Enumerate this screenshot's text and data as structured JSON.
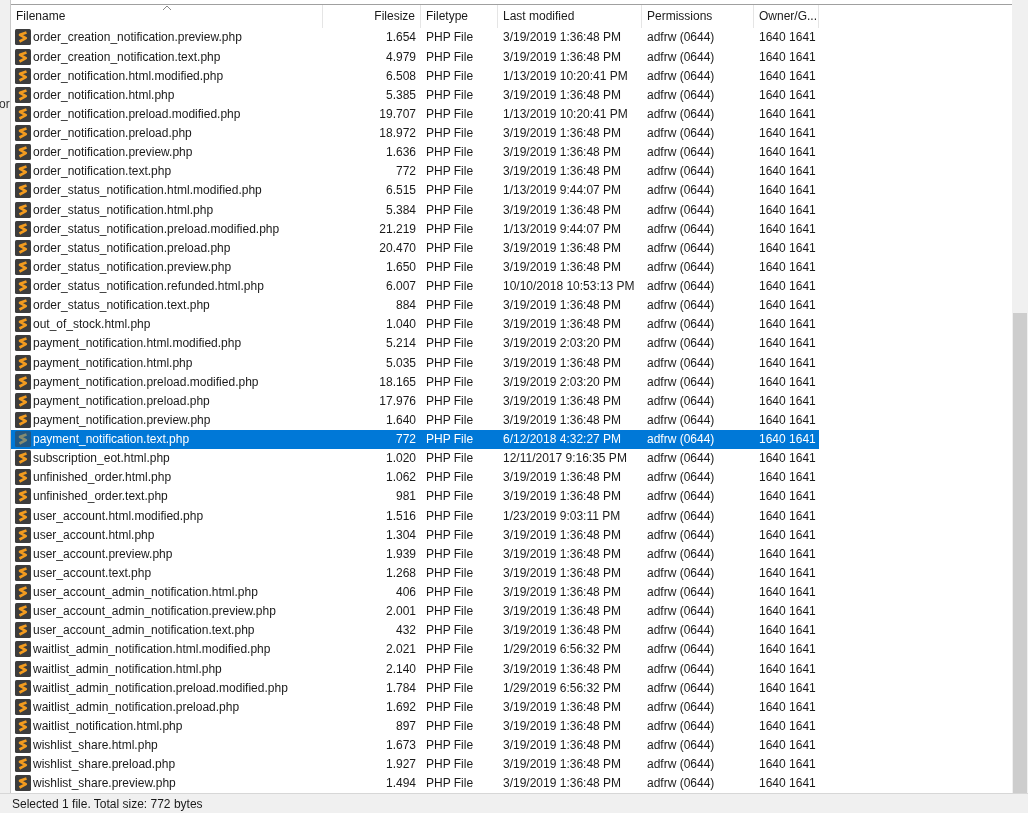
{
  "side_pane": {
    "fragment": "or"
  },
  "table": {
    "columns": [
      {
        "label": "Filename",
        "sorted": true
      },
      {
        "label": "Filesize",
        "sorted": false
      },
      {
        "label": "Filetype",
        "sorted": false
      },
      {
        "label": "Last modified",
        "sorted": false
      },
      {
        "label": "Permissions",
        "sorted": false
      },
      {
        "label": "Owner/G...",
        "sorted": false
      }
    ],
    "rows": [
      {
        "cells": [
          "order_creation_notification.preview.php",
          "1.654",
          "PHP File",
          "3/19/2019 1:36:48 PM",
          "adfrw (0644)",
          "1640 1641"
        ],
        "selected": false
      },
      {
        "cells": [
          "order_creation_notification.text.php",
          "4.979",
          "PHP File",
          "3/19/2019 1:36:48 PM",
          "adfrw (0644)",
          "1640 1641"
        ],
        "selected": false
      },
      {
        "cells": [
          "order_notification.html.modified.php",
          "6.508",
          "PHP File",
          "1/13/2019 10:20:41 PM",
          "adfrw (0644)",
          "1640 1641"
        ],
        "selected": false
      },
      {
        "cells": [
          "order_notification.html.php",
          "5.385",
          "PHP File",
          "3/19/2019 1:36:48 PM",
          "adfrw (0644)",
          "1640 1641"
        ],
        "selected": false
      },
      {
        "cells": [
          "order_notification.preload.modified.php",
          "19.707",
          "PHP File",
          "1/13/2019 10:20:41 PM",
          "adfrw (0644)",
          "1640 1641"
        ],
        "selected": false
      },
      {
        "cells": [
          "order_notification.preload.php",
          "18.972",
          "PHP File",
          "3/19/2019 1:36:48 PM",
          "adfrw (0644)",
          "1640 1641"
        ],
        "selected": false
      },
      {
        "cells": [
          "order_notification.preview.php",
          "1.636",
          "PHP File",
          "3/19/2019 1:36:48 PM",
          "adfrw (0644)",
          "1640 1641"
        ],
        "selected": false
      },
      {
        "cells": [
          "order_notification.text.php",
          "772",
          "PHP File",
          "3/19/2019 1:36:48 PM",
          "adfrw (0644)",
          "1640 1641"
        ],
        "selected": false
      },
      {
        "cells": [
          "order_status_notification.html.modified.php",
          "6.515",
          "PHP File",
          "1/13/2019 9:44:07 PM",
          "adfrw (0644)",
          "1640 1641"
        ],
        "selected": false
      },
      {
        "cells": [
          "order_status_notification.html.php",
          "5.384",
          "PHP File",
          "3/19/2019 1:36:48 PM",
          "adfrw (0644)",
          "1640 1641"
        ],
        "selected": false
      },
      {
        "cells": [
          "order_status_notification.preload.modified.php",
          "21.219",
          "PHP File",
          "1/13/2019 9:44:07 PM",
          "adfrw (0644)",
          "1640 1641"
        ],
        "selected": false
      },
      {
        "cells": [
          "order_status_notification.preload.php",
          "20.470",
          "PHP File",
          "3/19/2019 1:36:48 PM",
          "adfrw (0644)",
          "1640 1641"
        ],
        "selected": false
      },
      {
        "cells": [
          "order_status_notification.preview.php",
          "1.650",
          "PHP File",
          "3/19/2019 1:36:48 PM",
          "adfrw (0644)",
          "1640 1641"
        ],
        "selected": false
      },
      {
        "cells": [
          "order_status_notification.refunded.html.php",
          "6.007",
          "PHP File",
          "10/10/2018 10:53:13 PM",
          "adfrw (0644)",
          "1640 1641"
        ],
        "selected": false
      },
      {
        "cells": [
          "order_status_notification.text.php",
          "884",
          "PHP File",
          "3/19/2019 1:36:48 PM",
          "adfrw (0644)",
          "1640 1641"
        ],
        "selected": false
      },
      {
        "cells": [
          "out_of_stock.html.php",
          "1.040",
          "PHP File",
          "3/19/2019 1:36:48 PM",
          "adfrw (0644)",
          "1640 1641"
        ],
        "selected": false
      },
      {
        "cells": [
          "payment_notification.html.modified.php",
          "5.214",
          "PHP File",
          "3/19/2019 2:03:20 PM",
          "adfrw (0644)",
          "1640 1641"
        ],
        "selected": false
      },
      {
        "cells": [
          "payment_notification.html.php",
          "5.035",
          "PHP File",
          "3/19/2019 1:36:48 PM",
          "adfrw (0644)",
          "1640 1641"
        ],
        "selected": false
      },
      {
        "cells": [
          "payment_notification.preload.modified.php",
          "18.165",
          "PHP File",
          "3/19/2019 2:03:20 PM",
          "adfrw (0644)",
          "1640 1641"
        ],
        "selected": false
      },
      {
        "cells": [
          "payment_notification.preload.php",
          "17.976",
          "PHP File",
          "3/19/2019 1:36:48 PM",
          "adfrw (0644)",
          "1640 1641"
        ],
        "selected": false
      },
      {
        "cells": [
          "payment_notification.preview.php",
          "1.640",
          "PHP File",
          "3/19/2019 1:36:48 PM",
          "adfrw (0644)",
          "1640 1641"
        ],
        "selected": false
      },
      {
        "cells": [
          "payment_notification.text.php",
          "772",
          "PHP File",
          "6/12/2018 4:32:27 PM",
          "adfrw (0644)",
          "1640 1641"
        ],
        "selected": true
      },
      {
        "cells": [
          "subscription_eot.html.php",
          "1.020",
          "PHP File",
          "12/11/2017 9:16:35 PM",
          "adfrw (0644)",
          "1640 1641"
        ],
        "selected": false
      },
      {
        "cells": [
          "unfinished_order.html.php",
          "1.062",
          "PHP File",
          "3/19/2019 1:36:48 PM",
          "adfrw (0644)",
          "1640 1641"
        ],
        "selected": false
      },
      {
        "cells": [
          "unfinished_order.text.php",
          "981",
          "PHP File",
          "3/19/2019 1:36:48 PM",
          "adfrw (0644)",
          "1640 1641"
        ],
        "selected": false
      },
      {
        "cells": [
          "user_account.html.modified.php",
          "1.516",
          "PHP File",
          "1/23/2019 9:03:11 PM",
          "adfrw (0644)",
          "1640 1641"
        ],
        "selected": false
      },
      {
        "cells": [
          "user_account.html.php",
          "1.304",
          "PHP File",
          "3/19/2019 1:36:48 PM",
          "adfrw (0644)",
          "1640 1641"
        ],
        "selected": false
      },
      {
        "cells": [
          "user_account.preview.php",
          "1.939",
          "PHP File",
          "3/19/2019 1:36:48 PM",
          "adfrw (0644)",
          "1640 1641"
        ],
        "selected": false
      },
      {
        "cells": [
          "user_account.text.php",
          "1.268",
          "PHP File",
          "3/19/2019 1:36:48 PM",
          "adfrw (0644)",
          "1640 1641"
        ],
        "selected": false
      },
      {
        "cells": [
          "user_account_admin_notification.html.php",
          "406",
          "PHP File",
          "3/19/2019 1:36:48 PM",
          "adfrw (0644)",
          "1640 1641"
        ],
        "selected": false
      },
      {
        "cells": [
          "user_account_admin_notification.preview.php",
          "2.001",
          "PHP File",
          "3/19/2019 1:36:48 PM",
          "adfrw (0644)",
          "1640 1641"
        ],
        "selected": false
      },
      {
        "cells": [
          "user_account_admin_notification.text.php",
          "432",
          "PHP File",
          "3/19/2019 1:36:48 PM",
          "adfrw (0644)",
          "1640 1641"
        ],
        "selected": false
      },
      {
        "cells": [
          "waitlist_admin_notification.html.modified.php",
          "2.021",
          "PHP File",
          "1/29/2019 6:56:32 PM",
          "adfrw (0644)",
          "1640 1641"
        ],
        "selected": false
      },
      {
        "cells": [
          "waitlist_admin_notification.html.php",
          "2.140",
          "PHP File",
          "3/19/2019 1:36:48 PM",
          "adfrw (0644)",
          "1640 1641"
        ],
        "selected": false
      },
      {
        "cells": [
          "waitlist_admin_notification.preload.modified.php",
          "1.784",
          "PHP File",
          "1/29/2019 6:56:32 PM",
          "adfrw (0644)",
          "1640 1641"
        ],
        "selected": false
      },
      {
        "cells": [
          "waitlist_admin_notification.preload.php",
          "1.692",
          "PHP File",
          "3/19/2019 1:36:48 PM",
          "adfrw (0644)",
          "1640 1641"
        ],
        "selected": false
      },
      {
        "cells": [
          "waitlist_notification.html.php",
          "897",
          "PHP File",
          "3/19/2019 1:36:48 PM",
          "adfrw (0644)",
          "1640 1641"
        ],
        "selected": false
      },
      {
        "cells": [
          "wishlist_share.html.php",
          "1.673",
          "PHP File",
          "3/19/2019 1:36:48 PM",
          "adfrw (0644)",
          "1640 1641"
        ],
        "selected": false
      },
      {
        "cells": [
          "wishlist_share.preload.php",
          "1.927",
          "PHP File",
          "3/19/2019 1:36:48 PM",
          "adfrw (0644)",
          "1640 1641"
        ],
        "selected": false
      },
      {
        "cells": [
          "wishlist_share.preview.php",
          "1.494",
          "PHP File",
          "3/19/2019 1:36:48 PM",
          "adfrw (0644)",
          "1640 1641"
        ],
        "selected": false
      }
    ]
  },
  "status_bar": {
    "text": "Selected 1 file. Total size: 772 bytes"
  }
}
